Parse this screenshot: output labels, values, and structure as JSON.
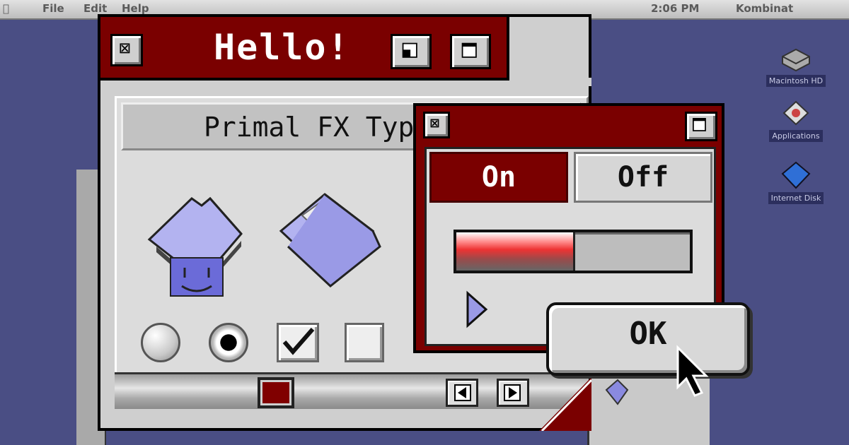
{
  "menubar": {
    "items": [
      "File",
      "Edit",
      "Help"
    ],
    "right": [
      "2:06 PM",
      "Kombinat"
    ]
  },
  "desktop": {
    "icons": [
      {
        "name": "hard-drive-icon",
        "label": "Macintosh HD"
      },
      {
        "name": "application-icon",
        "label": "Applications"
      },
      {
        "name": "disk-icon",
        "label": "Internet Disk"
      }
    ]
  },
  "main_window": {
    "title": "Hello!",
    "header": "Primal FX Typ",
    "icons": [
      "finder-folder-icon",
      "open-folder-icon"
    ],
    "radio_off": false,
    "radio_on": true,
    "checkbox_checked": true,
    "checkbox_unchecked": false
  },
  "toggle_window": {
    "segments": {
      "on_label": "On",
      "off_label": "Off",
      "selected": "On"
    },
    "progress": 0.5
  },
  "ok_button": {
    "label": "OK"
  },
  "colors": {
    "accent": "#7a0000",
    "desktop": "#4a4e84",
    "window": "#cfcfcf"
  }
}
